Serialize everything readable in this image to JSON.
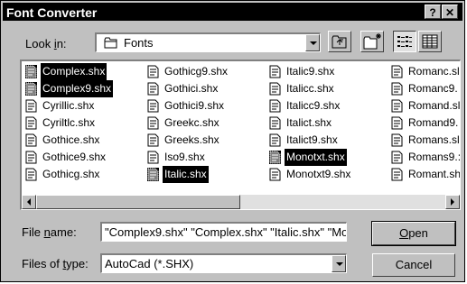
{
  "window": {
    "title": "Font Converter",
    "help_glyph": "?",
    "close_glyph": "✕"
  },
  "lookin": {
    "label_pre": "Look ",
    "label_ul": "i",
    "label_post": "n:",
    "value": "Fonts"
  },
  "files": [
    {
      "name": "Complex.shx",
      "selected": true
    },
    {
      "name": "Complex9.shx",
      "selected": true
    },
    {
      "name": "Cyrillic.shx",
      "selected": false
    },
    {
      "name": "Cyriltlc.shx",
      "selected": false
    },
    {
      "name": "Gothice.shx",
      "selected": false
    },
    {
      "name": "Gothice9.shx",
      "selected": false
    },
    {
      "name": "Gothicg.shx",
      "selected": false
    },
    {
      "name": "Gothicg9.shx",
      "selected": false
    },
    {
      "name": "Gothici.shx",
      "selected": false
    },
    {
      "name": "Gothici9.shx",
      "selected": false
    },
    {
      "name": "Greekc.shx",
      "selected": false
    },
    {
      "name": "Greeks.shx",
      "selected": false
    },
    {
      "name": "Iso9.shx",
      "selected": false
    },
    {
      "name": "Italic.shx",
      "selected": true
    },
    {
      "name": "Italic9.shx",
      "selected": false
    },
    {
      "name": "Italicc.shx",
      "selected": false
    },
    {
      "name": "Italicc9.shx",
      "selected": false
    },
    {
      "name": "Italict.shx",
      "selected": false
    },
    {
      "name": "Italict9.shx",
      "selected": false
    },
    {
      "name": "Monotxt.shx",
      "selected": true
    },
    {
      "name": "Monotxt9.shx",
      "selected": false
    },
    {
      "name": "Romanc.sl",
      "selected": false
    },
    {
      "name": "Romanc9.",
      "selected": false
    },
    {
      "name": "Romand.sl",
      "selected": false
    },
    {
      "name": "Romand9.",
      "selected": false
    },
    {
      "name": "Romans.sl",
      "selected": false
    },
    {
      "name": "Romans9.:",
      "selected": false
    },
    {
      "name": "Romant.sh",
      "selected": false
    }
  ],
  "filename": {
    "label_pre": "File ",
    "label_ul": "n",
    "label_post": "ame:",
    "value": "\"Complex9.shx\" \"Complex.shx\" \"Italic.shx\" \"Mo"
  },
  "filetype": {
    "label_pre": "Files of ",
    "label_ul": "t",
    "label_post": "ype:",
    "value": "AutoCad (*.SHX)"
  },
  "buttons": {
    "open_ul": "O",
    "open_rest": "pen",
    "cancel": "Cancel"
  }
}
